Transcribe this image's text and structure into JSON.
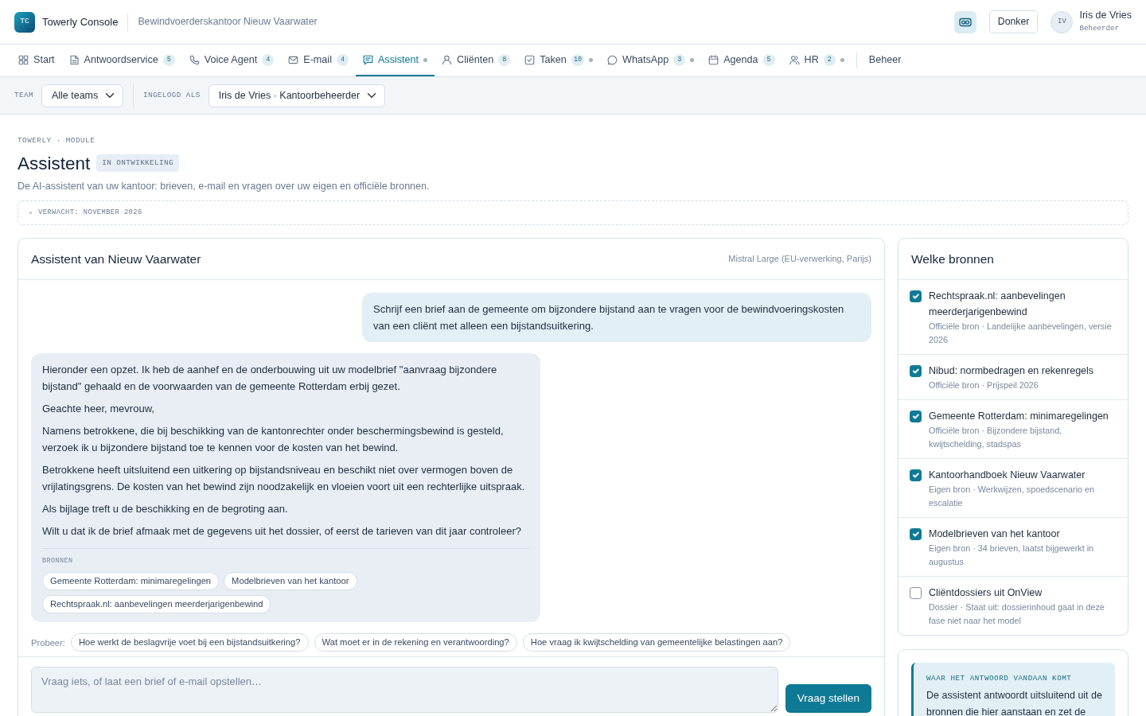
{
  "topbar": {
    "logo": "TC",
    "app_name": "Towerly Console",
    "office": "Bewindvoerderskantoor Nieuw Vaarwater",
    "theme_button": "Donker",
    "user": {
      "initials": "IV",
      "name": "Iris de Vries",
      "role": "Beheerder"
    }
  },
  "tabs": [
    {
      "label": "Start",
      "selected": false,
      "dot": false
    },
    {
      "label": "Antwoordservice",
      "count": "5",
      "selected": false,
      "dot": false
    },
    {
      "label": "Voice Agent",
      "count": "4",
      "selected": false,
      "dot": false
    },
    {
      "label": "E-mail",
      "count": "4",
      "selected": false,
      "dot": false
    },
    {
      "label": "Assistent",
      "selected": true,
      "dot": true
    },
    {
      "label": "Cliënten",
      "count": "8",
      "selected": false,
      "dot": false
    },
    {
      "label": "Taken",
      "count": "10",
      "selected": false,
      "dot": true
    },
    {
      "label": "WhatsApp",
      "count": "3",
      "selected": false,
      "dot": true
    },
    {
      "label": "Agenda",
      "count": "5",
      "selected": false,
      "dot": false
    },
    {
      "label": "HR",
      "count": "2",
      "selected": false,
      "dot": true
    }
  ],
  "admin_link": {
    "label": "Beheer"
  },
  "filters": [
    {
      "label": "TEAM",
      "value": "Alle teams"
    },
    {
      "label": "INGELOGD ALS",
      "value": "Iris de Vries · Kantoorbeheerder"
    }
  ],
  "page": {
    "eyebrow": "TOWERLY · MODULE",
    "title": "Assistent",
    "status_badge": "IN ONTWIKKELING",
    "description": "De AI-assistent van uw kantoor: brieven, e-mail en vragen over uw eigen en officiële bronnen.",
    "expected": "VERWACHT: NOVEMBER 2026"
  },
  "chat": {
    "title": "Assistent van Nieuw Vaarwater",
    "model": "Mistral Large (EU-verwerking, Parijs)",
    "messages": [
      {
        "kind": "user",
        "paragraphs": [
          "Schrijf een brief aan de gemeente om bijzondere bijstand aan te vragen voor de bewindvoeringskosten van een cliënt met alleen een bijstandsuitkering."
        ]
      },
      {
        "kind": "assistant",
        "paragraphs": [
          "Hieronder een opzet. Ik heb de aanhef en de onderbouwing uit uw modelbrief \"aanvraag bijzondere bijstand\" gehaald en de voorwaarden van de gemeente Rotterdam erbij gezet.",
          "Geachte heer, mevrouw,",
          "Namens betrokkene, die bij beschikking van de kantonrechter onder beschermingsbewind is gesteld, verzoek ik u bijzondere bijstand toe te kennen voor de kosten van het bewind.",
          "Betrokkene heeft uitsluitend een uitkering op bijstandsniveau en beschikt niet over vermogen boven de vrijlatingsgrens. De kosten van het bewind zijn noodzakelijk en vloeien voort uit een rechterlijke uitspraak.",
          "Als bijlage treft u de beschikking en de begroting aan.",
          "Wilt u dat ik de brief afmaak met de gegevens uit het dossier, of eerst de tarieven van dit jaar controleer?"
        ],
        "sources_label": "BRONNEN",
        "sources": [
          "Gemeente Rotterdam: minimaregelingen",
          "Modelbrieven van het kantoor",
          "Rechtspraak.nl: aanbevelingen meerderjarigenbewind"
        ]
      }
    ],
    "suggestions_label": "Probeer:",
    "suggestions": [
      "Hoe werkt de beslagvrije voet bij een bijstandsuitkering?",
      "Wat moet er in de rekening en verantwoording?",
      "Hoe vraag ik kwijtschelding van gemeentelijke belastingen aan?"
    ],
    "input": {
      "placeholder": "Vraag iets, of laat een brief of e-mail opstellen…"
    },
    "send_button": "Vraag stellen"
  },
  "sources_panel": {
    "title": "Welke bronnen",
    "items": [
      {
        "title": "Rechtspraak.nl: aanbevelingen meerderjarigenbewind",
        "meta": "Officiële bron · Landelijke aanbevelingen, versie 2026",
        "checked": true
      },
      {
        "title": "Nibud: normbedragen en rekenregels",
        "meta": "Officiële bron · Prijspeil 2026",
        "checked": true
      },
      {
        "title": "Gemeente Rotterdam: minimaregelingen",
        "meta": "Officiële bron · Bijzondere bijstand, kwijtschelding, stadspas",
        "checked": true
      },
      {
        "title": "Kantoorhandboek Nieuw Vaarwater",
        "meta": "Eigen bron · Werkwijzen, spoedscenario en escalatie",
        "checked": true
      },
      {
        "title": "Modelbrieven van het kantoor",
        "meta": "Eigen bron · 34 brieven, laatst bijgewerkt in augustus",
        "checked": true
      },
      {
        "title": "Cliëntdossiers uit OnView",
        "meta": "Dossier · Staat uit: dossierinhoud gaat in deze fase niet naar het model",
        "checked": false
      }
    ]
  },
  "info_panel": {
    "title": "WAAR HET ANTWOORD VANDAAN KOMT",
    "text": "De assistent antwoordt uitsluitend uit de bronnen die hier aanstaan en zet de"
  }
}
